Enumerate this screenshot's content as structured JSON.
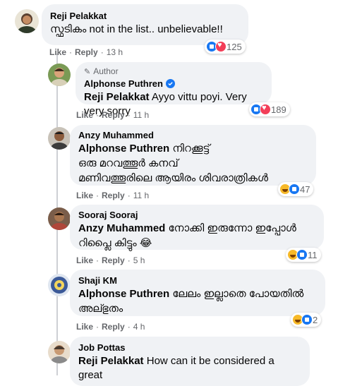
{
  "comments": [
    {
      "name": "Reji Pelakkat",
      "mention": "",
      "text": "സ്ഫടികം not in the list.. unbelievable!!",
      "like": "Like",
      "reply": "Reply",
      "time": "13 h",
      "reactions": "125",
      "react_icons": [
        "like-icon",
        "love-icon"
      ]
    },
    {
      "author_tag": "Author",
      "name": "Alphonse Puthren",
      "verified": true,
      "mention": "Reji Pelakkat",
      "text": " Ayyo vittu poyi. Very very sorry",
      "like": "Like",
      "reply": "Reply",
      "time": "11 h",
      "reactions": "189",
      "react_icons": [
        "like-icon",
        "love-icon"
      ]
    },
    {
      "name": "Anzy Muhammed",
      "mention": "Alphonse Puthren",
      "text_line1": " നിറക്കൂട്ട്",
      "text_line2": "ഒരു മറവത്തൂർ കനവ്",
      "text_line3": "മണിവത്തൂരിലെ ആയിരം ശിവരാത്രികൾ",
      "like": "Like",
      "reply": "Reply",
      "time": "11 h",
      "reactions": "47",
      "react_icons": [
        "haha-icon",
        "like-icon"
      ]
    },
    {
      "name": "Sooraj Sooraj",
      "mention": "Anzy Muhammed",
      "text_line1": " നോക്കി ഇരുന്നോ ഇപ്പോൾ",
      "text_line2": "റിപ്ലൈ കിട്ടും 😂",
      "like": "Like",
      "reply": "Reply",
      "time": "5 h",
      "reactions": "11",
      "react_icons": [
        "haha-icon",
        "like-icon"
      ]
    },
    {
      "name": "Shaji KM",
      "mention": "Alphonse Puthren",
      "text_line1": " ലേലം ഇല്ലാതെ പോയതിൽ",
      "text_line2": "അല്ഭുതം",
      "like": "Like",
      "reply": "Reply",
      "time": "4 h",
      "reactions": "2",
      "react_icons": [
        "haha-icon",
        "like-icon"
      ]
    },
    {
      "name": "Job Pottas",
      "mention": "Reji Pelakkat",
      "text": " How can it be considered a great"
    }
  ]
}
